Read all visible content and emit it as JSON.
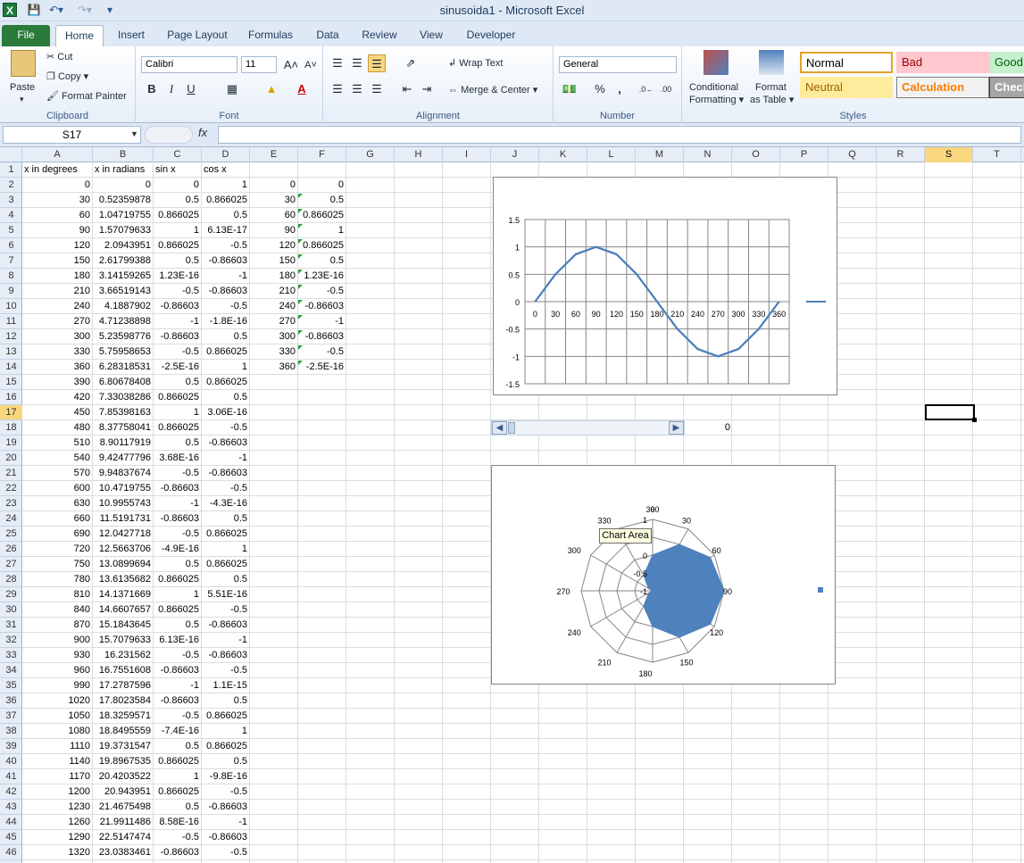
{
  "window": {
    "title": "sinusoida1  -  Microsoft Excel"
  },
  "ribbon": {
    "tabs": [
      "File",
      "Home",
      "Insert",
      "Page Layout",
      "Formulas",
      "Data",
      "Review",
      "View",
      "Developer"
    ],
    "clipboard": {
      "paste": "Paste",
      "cut": "Cut",
      "copy": "Copy",
      "format_painter": "Format Painter",
      "label": "Clipboard"
    },
    "font": {
      "name": "Calibri",
      "size": "11",
      "bold": "B",
      "italic": "I",
      "underline": "U",
      "label": "Font"
    },
    "alignment": {
      "wrap": "Wrap Text",
      "merge": "Merge & Center",
      "label": "Alignment"
    },
    "number": {
      "format": "General",
      "percent": "%",
      "comma": ",",
      "label": "Number"
    },
    "styles": {
      "conditional1": "Conditional",
      "conditional2": "Formatting",
      "format_table1": "Format",
      "format_table2": "as Table",
      "label": "Styles",
      "cells": [
        {
          "name": "Normal",
          "bg": "#ffffff",
          "fg": "#000000",
          "border": "#e5a12a"
        },
        {
          "name": "Bad",
          "bg": "#ffc7ce",
          "fg": "#9c0006",
          "border": "#ffc7ce"
        },
        {
          "name": "Good",
          "bg": "#c6efce",
          "fg": "#006100",
          "border": "#c6efce"
        },
        {
          "name": "Neutral",
          "bg": "#ffeb9c",
          "fg": "#9c6500",
          "border": "#ffeb9c"
        },
        {
          "name": "Calculation",
          "bg": "#f2f2f2",
          "fg": "#fa7d00",
          "border": "#7f7f7f"
        },
        {
          "name": "Check",
          "bg": "#a5a5a5",
          "fg": "#ffffff",
          "border": "#3f3f3f"
        }
      ]
    }
  },
  "formula_bar": {
    "name_box": "S17",
    "fx": "fx",
    "value": ""
  },
  "columns": [
    "A",
    "B",
    "C",
    "D",
    "E",
    "F",
    "G",
    "H",
    "I",
    "J",
    "K",
    "L",
    "M",
    "N",
    "O",
    "P",
    "Q",
    "R",
    "S",
    "T"
  ],
  "selected_column": "S",
  "selected_row": 17,
  "headers": {
    "A": "x in degrees",
    "B": "x in radians",
    "C": "sin x",
    "D": "cos x"
  },
  "rows": [
    [
      "0",
      "0",
      "0",
      "1",
      "0",
      "0"
    ],
    [
      "30",
      "0.52359878",
      "0.5",
      "0.866025",
      "30",
      "0.5"
    ],
    [
      "60",
      "1.04719755",
      "0.866025",
      "0.5",
      "60",
      "0.866025"
    ],
    [
      "90",
      "1.57079633",
      "1",
      "6.13E-17",
      "90",
      "1"
    ],
    [
      "120",
      "2.0943951",
      "0.866025",
      "-0.5",
      "120",
      "0.866025"
    ],
    [
      "150",
      "2.61799388",
      "0.5",
      "-0.86603",
      "150",
      "0.5"
    ],
    [
      "180",
      "3.14159265",
      "1.23E-16",
      "-1",
      "180",
      "1.23E-16"
    ],
    [
      "210",
      "3.66519143",
      "-0.5",
      "-0.86603",
      "210",
      "-0.5"
    ],
    [
      "240",
      "4.1887902",
      "-0.86603",
      "-0.5",
      "240",
      "-0.86603"
    ],
    [
      "270",
      "4.71238898",
      "-1",
      "-1.8E-16",
      "270",
      "-1"
    ],
    [
      "300",
      "5.23598776",
      "-0.86603",
      "0.5",
      "300",
      "-0.86603"
    ],
    [
      "330",
      "5.75958653",
      "-0.5",
      "0.866025",
      "330",
      "-0.5"
    ],
    [
      "360",
      "6.28318531",
      "-2.5E-16",
      "1",
      "360",
      "-2.5E-16"
    ],
    [
      "390",
      "6.80678408",
      "0.5",
      "0.866025",
      "",
      ""
    ],
    [
      "420",
      "7.33038286",
      "0.866025",
      "0.5",
      "",
      ""
    ],
    [
      "450",
      "7.85398163",
      "1",
      "3.06E-16",
      "",
      ""
    ],
    [
      "480",
      "8.37758041",
      "0.866025",
      "-0.5",
      "",
      ""
    ],
    [
      "510",
      "8.90117919",
      "0.5",
      "-0.86603",
      "",
      ""
    ],
    [
      "540",
      "9.42477796",
      "3.68E-16",
      "-1",
      "",
      ""
    ],
    [
      "570",
      "9.94837674",
      "-0.5",
      "-0.86603",
      "",
      ""
    ],
    [
      "600",
      "10.4719755",
      "-0.86603",
      "-0.5",
      "",
      ""
    ],
    [
      "630",
      "10.9955743",
      "-1",
      "-4.3E-16",
      "",
      ""
    ],
    [
      "660",
      "11.5191731",
      "-0.86603",
      "0.5",
      "",
      ""
    ],
    [
      "690",
      "12.0427718",
      "-0.5",
      "0.866025",
      "",
      ""
    ],
    [
      "720",
      "12.5663706",
      "-4.9E-16",
      "1",
      "",
      ""
    ],
    [
      "750",
      "13.0899694",
      "0.5",
      "0.866025",
      "",
      ""
    ],
    [
      "780",
      "13.6135682",
      "0.866025",
      "0.5",
      "",
      ""
    ],
    [
      "810",
      "14.1371669",
      "1",
      "5.51E-16",
      "",
      ""
    ],
    [
      "840",
      "14.6607657",
      "0.866025",
      "-0.5",
      "",
      ""
    ],
    [
      "870",
      "15.1843645",
      "0.5",
      "-0.86603",
      "",
      ""
    ],
    [
      "900",
      "15.7079633",
      "6.13E-16",
      "-1",
      "",
      ""
    ],
    [
      "930",
      "16.231562",
      "-0.5",
      "-0.86603",
      "",
      ""
    ],
    [
      "960",
      "16.7551608",
      "-0.86603",
      "-0.5",
      "",
      ""
    ],
    [
      "990",
      "17.2787596",
      "-1",
      "1.1E-15",
      "",
      ""
    ],
    [
      "1020",
      "17.8023584",
      "-0.86603",
      "0.5",
      "",
      ""
    ],
    [
      "1050",
      "18.3259571",
      "-0.5",
      "0.866025",
      "",
      ""
    ],
    [
      "1080",
      "18.8495559",
      "-7.4E-16",
      "1",
      "",
      ""
    ],
    [
      "1110",
      "19.3731547",
      "0.5",
      "0.866025",
      "",
      ""
    ],
    [
      "1140",
      "19.8967535",
      "0.866025",
      "0.5",
      "",
      ""
    ],
    [
      "1170",
      "20.4203522",
      "1",
      "-9.8E-16",
      "",
      ""
    ],
    [
      "1200",
      "20.943951",
      "0.866025",
      "-0.5",
      "",
      ""
    ],
    [
      "1230",
      "21.4675498",
      "0.5",
      "-0.86603",
      "",
      ""
    ],
    [
      "1260",
      "21.9911486",
      "8.58E-16",
      "-1",
      "",
      ""
    ],
    [
      "1290",
      "22.5147474",
      "-0.5",
      "-0.86603",
      "",
      ""
    ],
    [
      "1320",
      "23.0383461",
      "-0.86603",
      "-0.5",
      "",
      ""
    ]
  ],
  "scrollbar": {
    "value": "0"
  },
  "tooltip": "Chart Area",
  "chart_data": [
    {
      "type": "line",
      "categories": [
        "0",
        "30",
        "60",
        "90",
        "120",
        "150",
        "180",
        "210",
        "240",
        "270",
        "300",
        "330",
        "360"
      ],
      "series": [
        {
          "values": [
            0,
            0.5,
            0.866025,
            1,
            0.866025,
            0.5,
            0,
            -0.5,
            -0.86603,
            -1,
            -0.86603,
            -0.5,
            0
          ],
          "color": "#4a7ebb"
        }
      ],
      "ylim": [
        -1.5,
        1.5
      ],
      "yticks": [
        "1.5",
        "1",
        "0.5",
        "0",
        "-0.5",
        "-1",
        "-1.5"
      ],
      "grid": true,
      "legend": "right"
    },
    {
      "type": "radar",
      "categories": [
        "0",
        "30",
        "60",
        "90",
        "120",
        "150",
        "180",
        "210",
        "240",
        "270",
        "300",
        "330",
        "360"
      ],
      "series": [
        {
          "values": [
            0,
            0.5,
            0.866025,
            1,
            0.866025,
            0.5,
            0,
            -0.5,
            -0.86603,
            -1,
            -0.86603,
            -0.5,
            0
          ],
          "color": "#4f81bd"
        }
      ],
      "ylim": [
        -1,
        1
      ],
      "rticks": [
        "1",
        "0.5",
        "0",
        "-0.5",
        "-1"
      ],
      "legend": "right"
    }
  ]
}
